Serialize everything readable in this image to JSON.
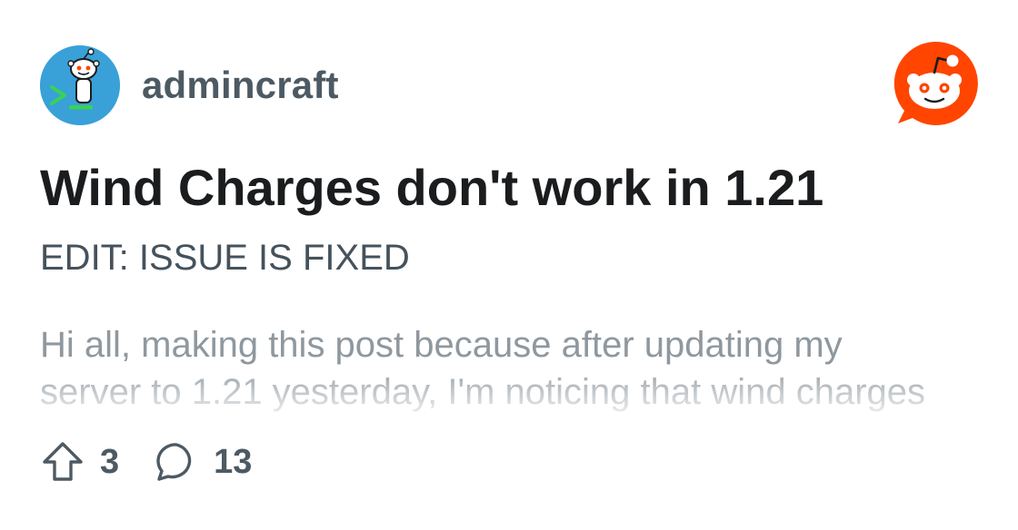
{
  "post": {
    "subreddit": "admincraft",
    "title": "Wind Charges don't work in 1.21",
    "subtitle": "EDIT: ISSUE IS FIXED",
    "body_lines": [
      "Hi all, making this post because after updating my",
      "server to 1.21 yesterday, I'm noticing that wind charges"
    ],
    "upvotes": "3",
    "comments": "13"
  },
  "icons": {
    "avatar": "subreddit-avatar-snoo-terminal",
    "logo": "reddit-logo-icon",
    "upvote": "upvote-arrow-icon",
    "comment": "comment-bubble-icon"
  },
  "colors": {
    "reddit_orange": "#ff4500",
    "avatar_bg": "#3aa0d8",
    "title": "#1a1c1e",
    "meta": "#4d5a63",
    "body": "#8f989f"
  }
}
